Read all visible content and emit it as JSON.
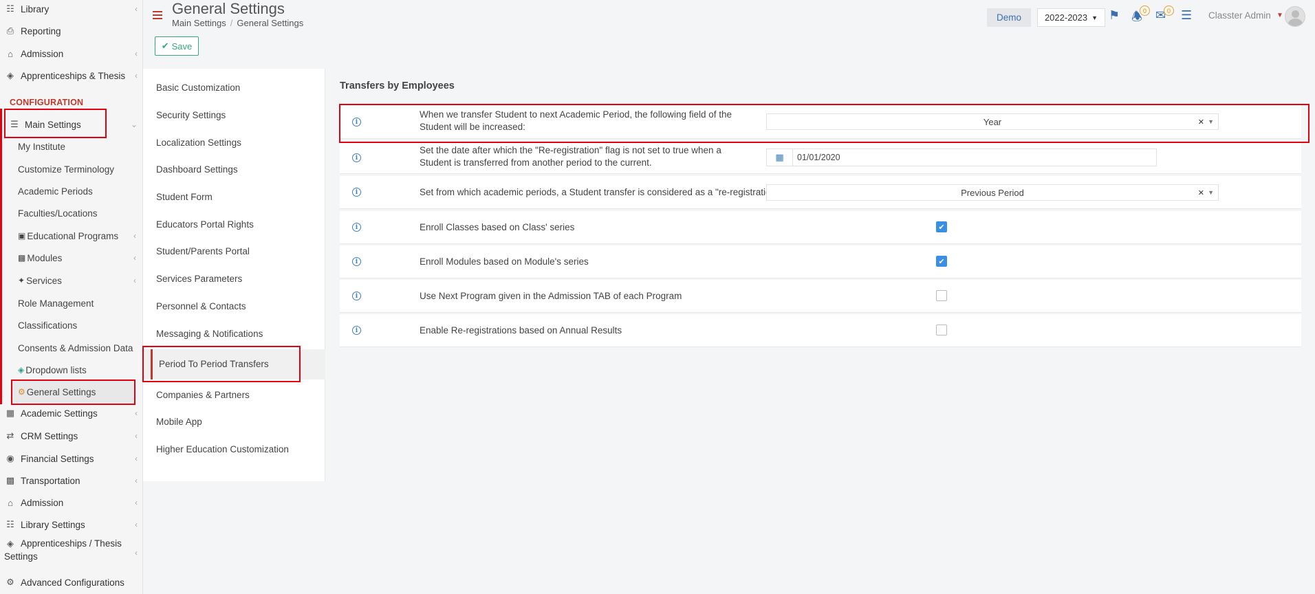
{
  "sidebar": {
    "top_items": [
      {
        "label": "Library",
        "icon": "library-icon"
      },
      {
        "label": "Reporting",
        "icon": "printer-icon"
      },
      {
        "label": "Admission",
        "icon": "bank-icon"
      },
      {
        "label": "Apprenticeships & Thesis",
        "icon": "cube-icon"
      }
    ],
    "section_header": "CONFIGURATION",
    "main_settings": {
      "label": "Main Settings",
      "icon": "sliders-icon"
    },
    "sub_items": [
      {
        "label": "My Institute"
      },
      {
        "label": "Customize Terminology"
      },
      {
        "label": "Academic Periods"
      },
      {
        "label": "Faculties/Locations"
      },
      {
        "label": "Educational Programs",
        "icon": "monitor-icon"
      },
      {
        "label": "Modules",
        "icon": "book-icon"
      },
      {
        "label": "Services",
        "icon": "services-icon"
      },
      {
        "label": "Role Management"
      },
      {
        "label": "Classifications"
      },
      {
        "label": "Consents & Admission Data"
      },
      {
        "label": "Dropdown lists",
        "icon": "layers-icon"
      },
      {
        "label": "General Settings",
        "icon": "gear-icon"
      }
    ],
    "bottom_items": [
      {
        "label": "Academic Settings",
        "icon": "sitemap-icon"
      },
      {
        "label": "CRM Settings",
        "icon": "shuffle-icon"
      },
      {
        "label": "Financial Settings",
        "icon": "coins-icon"
      },
      {
        "label": "Transportation",
        "icon": "bus-icon"
      },
      {
        "label": "Admission",
        "icon": "bank-icon"
      },
      {
        "label": "Library Settings",
        "icon": "library-icon"
      },
      {
        "label": "Apprenticeships / Thesis",
        "label2": "Settings",
        "icon": "cube-icon"
      },
      {
        "label": "Advanced Configurations",
        "icon": "gears-icon"
      }
    ]
  },
  "header": {
    "title": "General Settings",
    "breadcrumb": [
      "Main Settings",
      "General Settings"
    ],
    "demo_label": "Demo",
    "year": "2022-2023",
    "notifications_count": "0",
    "messages_count": "0",
    "user_name": "Classter Admin"
  },
  "toolbar": {
    "save_label": "Save"
  },
  "settings_nav": {
    "items": [
      "Basic Customization",
      "Security Settings",
      "Localization Settings",
      "Dashboard Settings",
      "Student Form",
      "Educators Portal Rights",
      "Student/Parents Portal",
      "Services Parameters",
      "Personnel & Contacts",
      "Messaging & Notifications",
      "Period To Period Transfers",
      "Companies & Partners",
      "Mobile App",
      "Higher Education Customization"
    ],
    "active": "Period To Period Transfers"
  },
  "content": {
    "section_title": "Transfers by Employees",
    "rows": [
      {
        "text": "When we transfer Student to next Academic Period, the following field of the Student will be increased:",
        "control": "select",
        "value": "Year"
      },
      {
        "text": "Set the date after which the \"Re-registration\" flag is not set to true when a Student is transferred from another period to the current.",
        "control": "date",
        "value": "01/01/2020"
      },
      {
        "text": "Set from which academic periods, a Student transfer is considered as a \"re-registration\"",
        "control": "select",
        "value": "Previous Period"
      },
      {
        "text": "Enroll Classes based on Class' series",
        "control": "checkbox",
        "checked": true
      },
      {
        "text": "Enroll Modules based on Module's series",
        "control": "checkbox",
        "checked": true
      },
      {
        "text": "Use Next Program given in the Admission TAB of each Program",
        "control": "checkbox",
        "checked": false
      },
      {
        "text": "Enable Re-registrations based on Annual Results",
        "control": "checkbox",
        "checked": false
      }
    ]
  },
  "colors": {
    "accent_red": "#c0392b",
    "highlight_red": "#e3000f",
    "link_blue": "#3a6fb0",
    "save_green": "#3aa57a",
    "checkbox_blue": "#3a8ee6"
  }
}
